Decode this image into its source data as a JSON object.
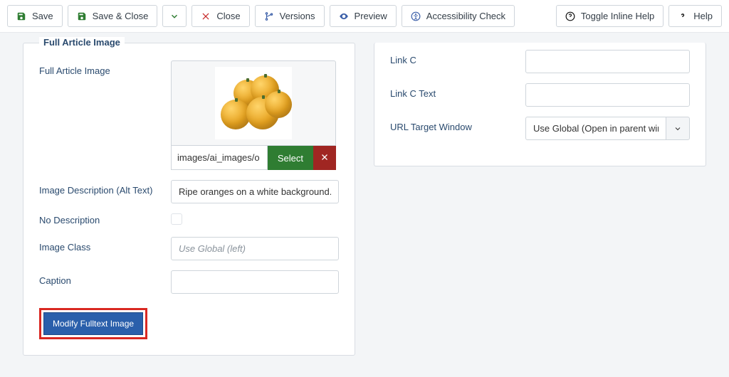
{
  "toolbar": {
    "save": "Save",
    "save_close": "Save & Close",
    "close": "Close",
    "versions": "Versions",
    "preview": "Preview",
    "accessibility": "Accessibility Check",
    "toggle_help": "Toggle Inline Help",
    "help": "Help"
  },
  "left_panel": {
    "legend": "Full Article Image",
    "image_label": "Full Article Image",
    "image_path": "images/ai_images/o",
    "select": "Select",
    "alt_label": "Image Description (Alt Text)",
    "alt_value": "Ripe oranges on a white background.",
    "no_desc_label": "No Description",
    "image_class_label": "Image Class",
    "image_class_placeholder": "Use Global (left)",
    "caption_label": "Caption",
    "modify_btn": "Modify Fulltext Image"
  },
  "right_panel": {
    "link_c_label": "Link C",
    "link_c_text_label": "Link C Text",
    "target_label": "URL Target Window",
    "target_value": "Use Global (Open in parent windo"
  }
}
